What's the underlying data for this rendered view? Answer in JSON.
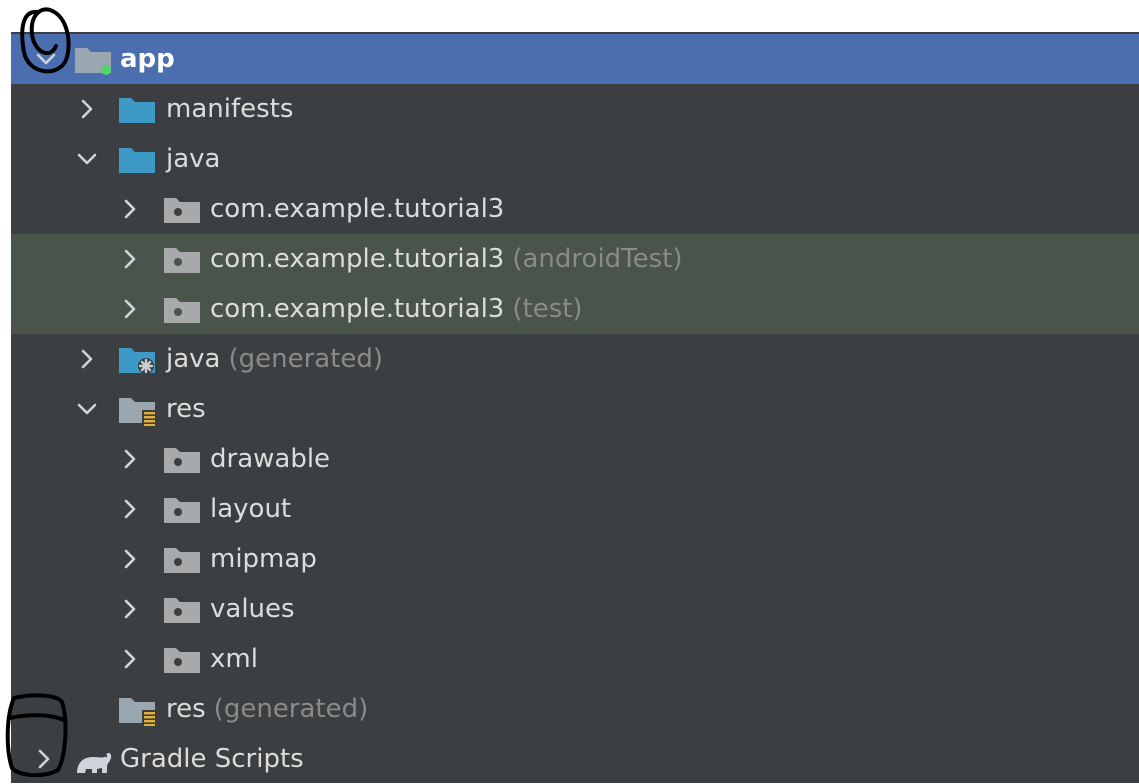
{
  "tree": {
    "app": {
      "label": "app"
    },
    "manifests": {
      "label": "manifests"
    },
    "java": {
      "label": "java"
    },
    "pkg_main": {
      "label": "com.example.tutorial3"
    },
    "pkg_android_test": {
      "label": "com.example.tutorial3",
      "suffix": "(androidTest)"
    },
    "pkg_test": {
      "label": "com.example.tutorial3",
      "suffix": "(test)"
    },
    "java_generated": {
      "label": "java",
      "suffix": "(generated)"
    },
    "res": {
      "label": "res"
    },
    "drawable": {
      "label": "drawable"
    },
    "layout": {
      "label": "layout"
    },
    "mipmap": {
      "label": "mipmap"
    },
    "values": {
      "label": "values"
    },
    "xml": {
      "label": "xml"
    },
    "res_generated": {
      "label": "res",
      "suffix": "(generated)"
    },
    "gradle_scripts": {
      "label": "Gradle Scripts"
    }
  },
  "colors": {
    "panel_bg": "#3c3f41",
    "selection": "#4b6eaf",
    "test_highlight": "#49544a",
    "folder_blue": "#3d9ac7",
    "package_gray": "#a7a9ab",
    "muted_text": "#8a8a8a"
  },
  "icons": {
    "expanded": "chevron-down-icon",
    "collapsed": "chevron-right-icon",
    "module": "module-folder-icon",
    "source_folder": "folder-icon",
    "package": "package-icon",
    "generated_sources": "generated-java-folder-icon",
    "resources": "resources-folder-icon",
    "gradle": "gradle-elephant-icon"
  }
}
